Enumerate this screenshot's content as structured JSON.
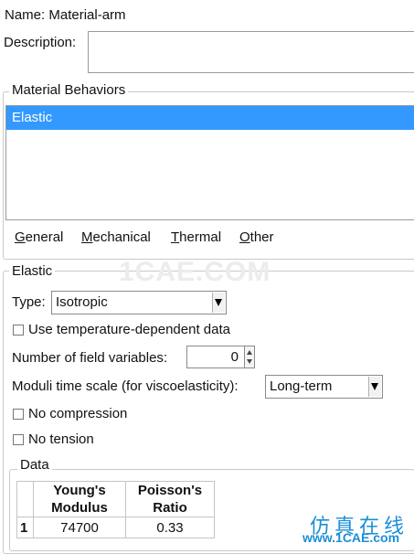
{
  "name": {
    "label": "Name:",
    "value": "Material-arm"
  },
  "description": {
    "label": "Description:",
    "value": ""
  },
  "behaviors": {
    "title": "Material Behaviors",
    "items": [
      "Elastic"
    ],
    "menu": [
      {
        "key": "G",
        "rest": "eneral"
      },
      {
        "key": "M",
        "rest": "echanical"
      },
      {
        "key": "T",
        "rest": "hermal"
      },
      {
        "key": "O",
        "rest": "ther"
      }
    ]
  },
  "elastic": {
    "title": "Elastic",
    "type_label": "Type:",
    "type_value": "Isotropic",
    "temp_dependent_label": "Use temperature-dependent data",
    "field_vars_label": "Number of field variables:",
    "field_vars_value": "0",
    "moduli_label": "Moduli time scale (for viscoelasticity):",
    "moduli_value": "Long-term",
    "no_compression_label": "No compression",
    "no_tension_label": "No tension"
  },
  "data": {
    "title": "Data",
    "columns": [
      {
        "line1": "Young's",
        "line2": "Modulus"
      },
      {
        "line1": "Poisson's",
        "line2": "Ratio"
      }
    ],
    "rows": [
      {
        "index": "1",
        "values": [
          "74700",
          "0.33"
        ]
      }
    ]
  },
  "watermark": "1CAE.COM",
  "logo": {
    "cn": "仿真在线",
    "url": "www.1CAE.com"
  },
  "colors": {
    "selection": "#3399ff",
    "logo": "#1b8fd6"
  }
}
